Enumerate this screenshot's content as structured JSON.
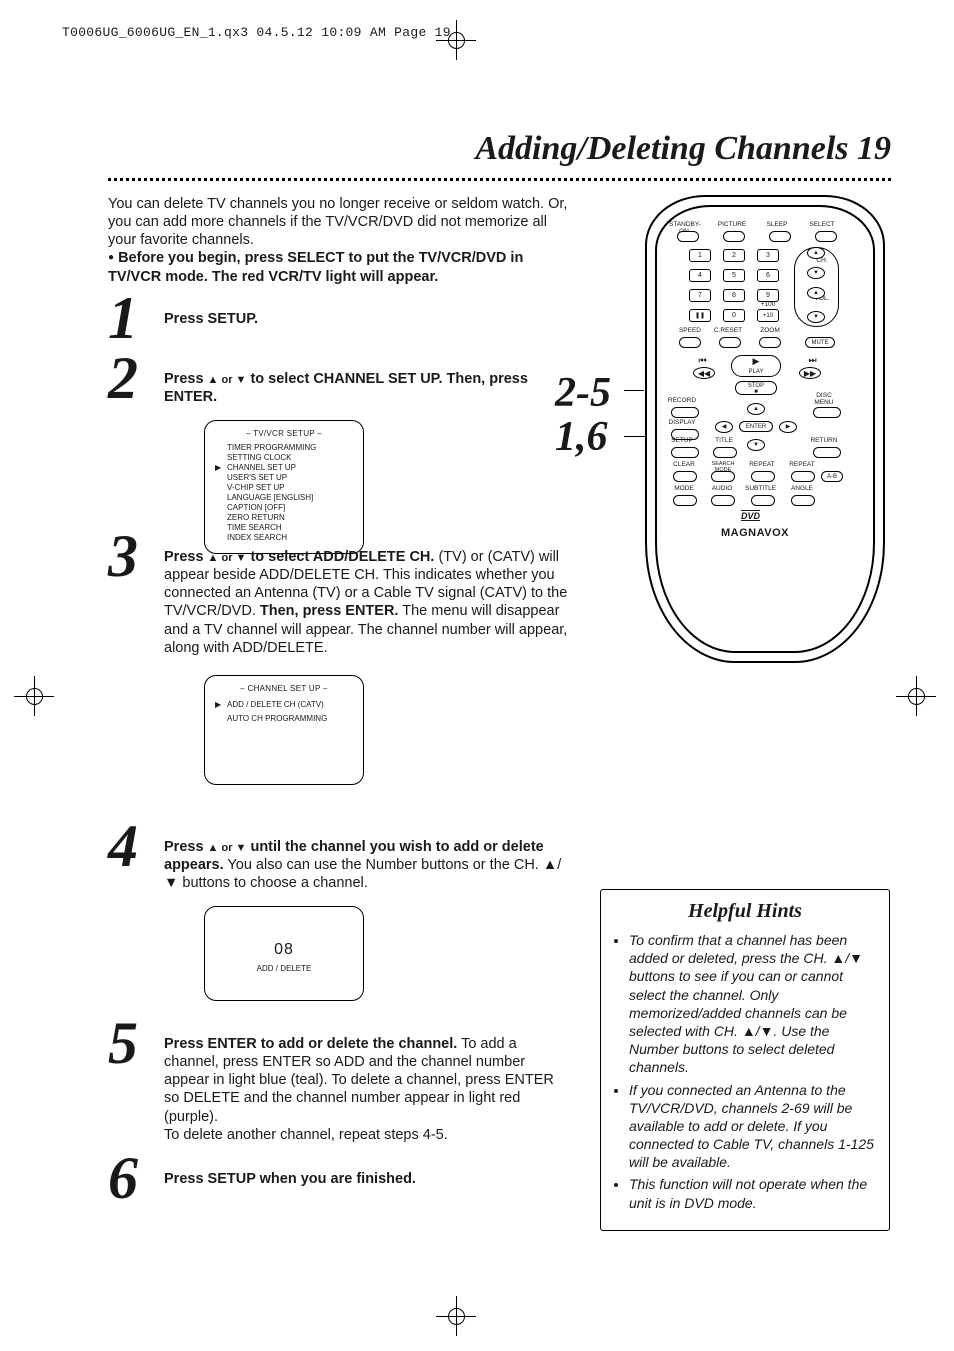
{
  "crop_header": "T0006UG_6006UG_EN_1.qx3  04.5.12  10:09 AM  Page 19",
  "title": "Adding/Deleting Channels  19",
  "intro": {
    "para": "You can delete TV channels you no longer receive or seldom watch. Or, you can add more channels if the TV/VCR/DVD did not memorize all your favorite channels.",
    "bullet": "Before you begin, press SELECT to put the TV/VCR/DVD in TV/VCR mode. The red VCR/TV light will appear."
  },
  "steps": {
    "s1": {
      "num": "1",
      "text": "Press SETUP."
    },
    "s2": {
      "num": "2",
      "prefix": "Press ",
      "arr": "▲ or ▼",
      "mid": " to select CHANNEL SET UP. Then, press ENTER."
    },
    "s3": {
      "num": "3",
      "prefix": "Press ",
      "arr": "▲ or ▼",
      "mid": " to select ADD/DELETE CH.",
      "rest": " (TV) or (CATV) will appear beside ADD/DELETE CH. This indicates whether you connected an Antenna (TV) or a Cable TV signal (CATV) to the TV/VCR/DVD. ",
      "bold2": "Then, press ENTER.",
      "rest2": " The menu will disappear and a TV channel will appear. The channel number will appear, along with ADD/DELETE."
    },
    "s4": {
      "num": "4",
      "prefix": "Press ",
      "arr": "▲ or ▼",
      "mid": " until the channel you wish to add or delete appears.",
      "rest": " You also can use the Number buttons or the CH. ▲/▼ buttons to choose a channel."
    },
    "s5": {
      "num": "5",
      "bold": "Press ENTER to add or delete the channel.",
      "rest": " To add a channel, press ENTER so ADD and the channel number appear in light blue (teal). To delete a channel, press ENTER so DELETE and the channel number appear in light red (purple).",
      "rest2": "To delete another channel, repeat steps 4-5."
    },
    "s6": {
      "num": "6",
      "text": "Press SETUP when you are finished."
    }
  },
  "osd2": {
    "hdr": "– TV/VCR SETUP –",
    "lines": [
      "TIMER PROGRAMMING",
      "SETTING CLOCK",
      "CHANNEL SET UP",
      "USER'S SET UP",
      "V-CHIP SET UP",
      "LANGUAGE  [ENGLISH]",
      "CAPTION   [OFF]",
      "ZERO RETURN",
      "TIME SEARCH",
      "INDEX SEARCH"
    ],
    "arrow_line_index": 2
  },
  "osd3": {
    "hdr": "– CHANNEL SET UP –",
    "lines": [
      "ADD / DELETE CH (CATV)",
      "AUTO CH PROGRAMMING"
    ]
  },
  "osd4": {
    "num": "08",
    "lbl": "ADD / DELETE"
  },
  "callouts": {
    "a": "2-5",
    "b": "1,6"
  },
  "hints": {
    "hdr": "Helpful Hints",
    "items": [
      "To confirm that a channel has been added or deleted, press the CH. ▲/▼ buttons to see if you can or cannot select the channel. Only memorized/added channels can be selected with CH. ▲/▼. Use the Number buttons to select deleted channels.",
      "If you connected an Antenna to the TV/VCR/DVD, channels 2-69 will be available to add or delete. If you connected to Cable TV, channels 1-125 will be available.",
      "This function will not operate when the unit is in DVD mode."
    ]
  },
  "remote": {
    "row1": [
      "STANDBY-ON",
      "PICTURE",
      "SLEEP",
      "SELECT"
    ],
    "digits": [
      "1",
      "2",
      "3",
      "4",
      "5",
      "6",
      "7",
      "8",
      "9",
      "0"
    ],
    "btns": {
      "plus100": "+100",
      "plus10": "+10",
      "ch": "CH.",
      "vol": "VOL.",
      "speed": "SPEED",
      "creset": "C.RESET",
      "zoom": "ZOOM",
      "mute": "MUTE",
      "play": "PLAY",
      "stop": "STOP",
      "record": "RECORD",
      "disc_menu": "DISC MENU",
      "display": "DISPLAY",
      "enter": "ENTER",
      "setup": "SETUP",
      "title": "TITLE",
      "return": "RETURN",
      "clear": "CLEAR",
      "searchmode": "SEARCH MODE",
      "repeat1": "REPEAT",
      "repeat2": "REPEAT",
      "ab": "A-B",
      "mode": "MODE",
      "audio": "AUDIO",
      "subtitle": "SUBTITLE",
      "angle": "ANGLE",
      "brand": "MAGNAVOX",
      "dvd": "DVD"
    }
  }
}
